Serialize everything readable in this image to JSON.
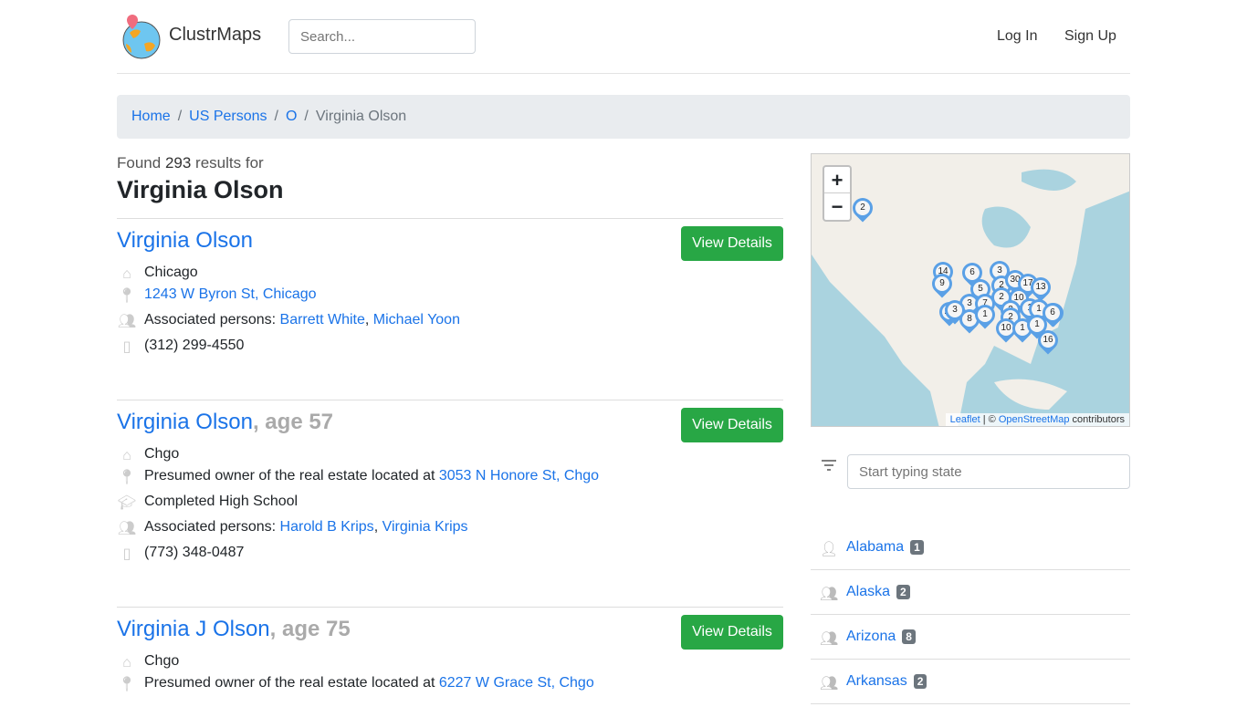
{
  "header": {
    "brand": "ClustrMaps",
    "search_placeholder": "Search...",
    "login": "Log In",
    "signup": "Sign Up"
  },
  "breadcrumb": [
    {
      "label": "Home"
    },
    {
      "label": "US Persons"
    },
    {
      "label": "O"
    },
    {
      "label": "Virginia Olson"
    }
  ],
  "summary": {
    "prefix": "Found",
    "count": "293",
    "suffix": "results for",
    "query": "Virginia Olson"
  },
  "results": [
    {
      "name": "Virginia Olson",
      "age": "",
      "button": "View Details",
      "city": "Chicago",
      "address": "1243 W Byron St, Chicago",
      "assoc_label": "Associated persons:",
      "assoc": [
        "Barrett White",
        "Michael Yoon"
      ],
      "phone": "(312) 299-4550"
    },
    {
      "name": "Virginia Olson",
      "age": ", age 57",
      "button": "View Details",
      "city": "Chgo",
      "address_prefix": "Presumed owner of the real estate located at",
      "address": "3053 N Honore St, Chgo",
      "education": "Completed High School",
      "assoc_label": "Associated persons:",
      "assoc": [
        "Harold B Krips",
        "Virginia Krips"
      ],
      "phone": "(773) 348-0487"
    },
    {
      "name": "Virginia J Olson",
      "age": ", age 75",
      "button": "View Details",
      "city": "Chgo",
      "address_prefix": "Presumed owner of the real estate located at",
      "address": "6227 W Grace St, Chgo"
    }
  ],
  "map": {
    "zoom_in": "+",
    "zoom_out": "−",
    "attribution": {
      "leaflet": "Leaflet",
      "sep": " | © ",
      "osm": "OpenStreetMap",
      "suffix": " contributors"
    },
    "markers": [
      "2",
      "14",
      "9",
      "6",
      "3",
      "5",
      "3",
      "7",
      "20",
      "8",
      "1",
      "3",
      "2",
      "30",
      "17",
      "13",
      "2",
      "10",
      "2",
      "6",
      "2",
      "1",
      "1",
      "10",
      "1",
      "1",
      "6",
      "16"
    ],
    "marker_color": "#5aa0e6"
  },
  "states": {
    "placeholder": "Start typing state",
    "items": [
      {
        "name": "Alabama",
        "count": "1"
      },
      {
        "name": "Alaska",
        "count": "2"
      },
      {
        "name": "Arizona",
        "count": "8"
      },
      {
        "name": "Arkansas",
        "count": "2"
      }
    ]
  },
  "colors": {
    "link": "#1a73e8",
    "button": "#28a745",
    "badge": "#6c757d"
  }
}
